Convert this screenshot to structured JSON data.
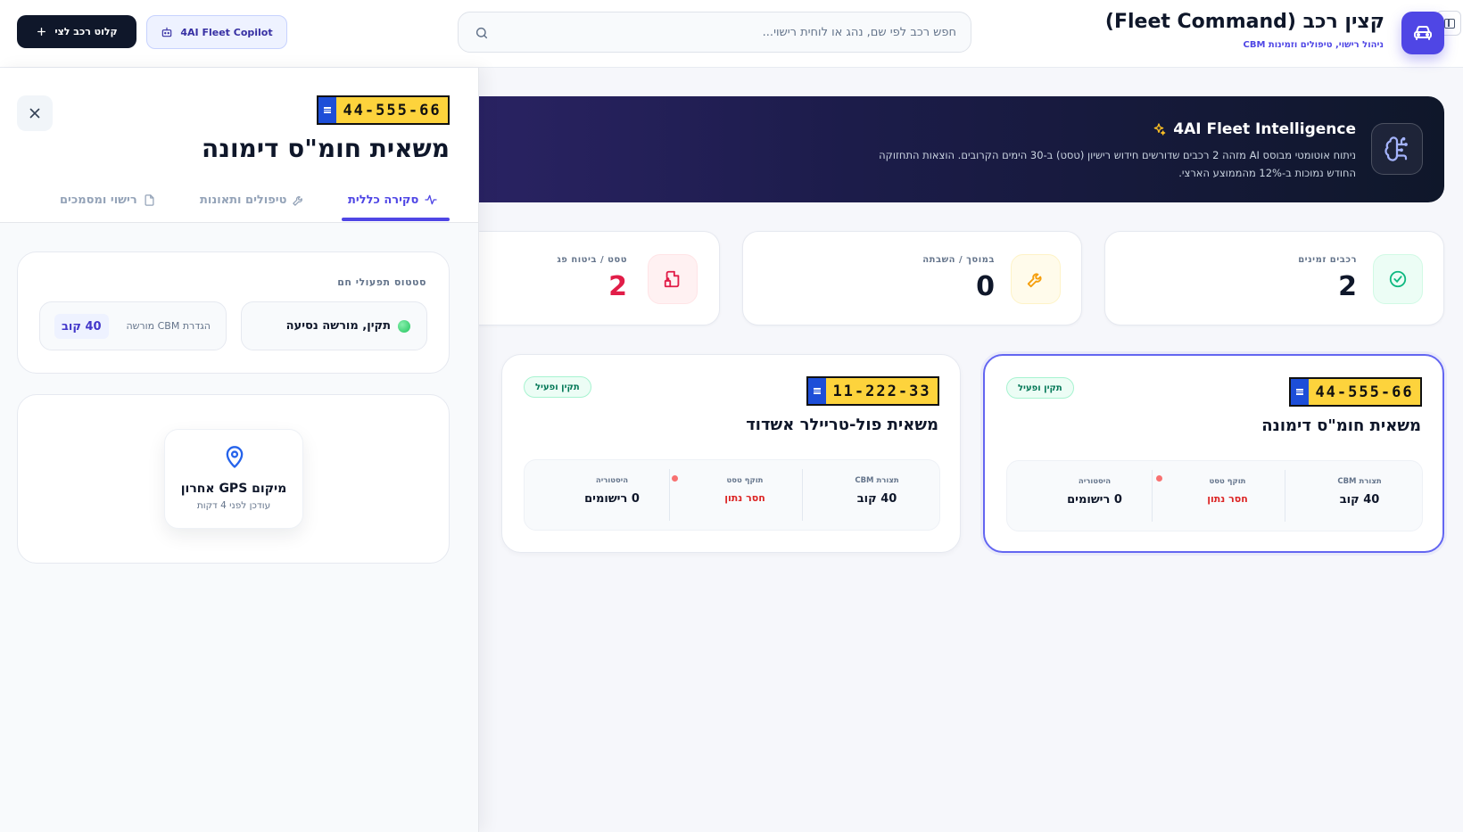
{
  "header": {
    "title": "קצין רכב (Fleet Command)",
    "subtitle": "ניהול רישוי, טיפולים וזמינות CBM",
    "search_placeholder": "חפש רכב לפי שם, נהג או לוחית רישוי...",
    "copilot_label": "4AI Fleet Copilot",
    "add_vehicle_label": "קלוט רכב לצי",
    "accent_color": "#4f46e5"
  },
  "banner": {
    "title": "4AI Fleet Intelligence",
    "text": "ניתוח אוטומטי מבוסס AI מזהה 2 רכבים שדורשים חידוש רישיון (טסט) ב-30 הימים הקרובים. הוצאות התחזוקה החודש נמוכות ב-12% מהממוצע הארצי."
  },
  "stats": [
    {
      "label": "רכבים זמינים",
      "value": "2",
      "icon": "check-circle-icon",
      "color": "#10b981"
    },
    {
      "label": "במוסך / השבתה",
      "value": "0",
      "icon": "wrench-icon",
      "color": "#f59e0b"
    },
    {
      "label": "טסט / ביטוח פג",
      "value": "2",
      "icon": "file-warning-icon",
      "color": "#e11d48"
    }
  ],
  "vehicles": [
    {
      "plate": "44-555-66",
      "name": "משאית חומ\"ס דימונה",
      "status": "תקין ופעיל",
      "cbm_label": "תצורת CBM",
      "cbm_value": "40 קוב",
      "test_label": "תוקף טסט",
      "test_value": "חסר נתון",
      "history_label": "היסטוריה",
      "history_value": "0 רישומים",
      "selected": true
    },
    {
      "plate": "11-222-33",
      "name": "משאית פול-טריילר אשדוד",
      "status": "תקין ופעיל",
      "cbm_label": "תצורת CBM",
      "cbm_value": "40 קוב",
      "test_label": "תוקף טסט",
      "test_value": "חסר נתון",
      "history_label": "היסטוריה",
      "history_value": "0 רישומים",
      "selected": false
    }
  ],
  "panel": {
    "plate": "44-555-66",
    "title": "משאית חומ\"ס דימונה",
    "tabs": [
      {
        "label": "סקירה כללית",
        "icon": "activity-icon",
        "active": true
      },
      {
        "label": "טיפולים ותאונות",
        "icon": "wrench-icon",
        "active": false
      },
      {
        "label": "רישוי ומסמכים",
        "icon": "file-icon",
        "active": false
      }
    ],
    "status_card": {
      "title": "סטטוס תפעולי חם",
      "status_text": "תקין, מורשה נסיעה",
      "cbm_label": "הגדרת CBM מורשה",
      "cbm_value": "40 קוב"
    },
    "gps": {
      "title": "מיקום GPS אחרון",
      "updated": "עודכן לפני 4 דקות"
    }
  }
}
